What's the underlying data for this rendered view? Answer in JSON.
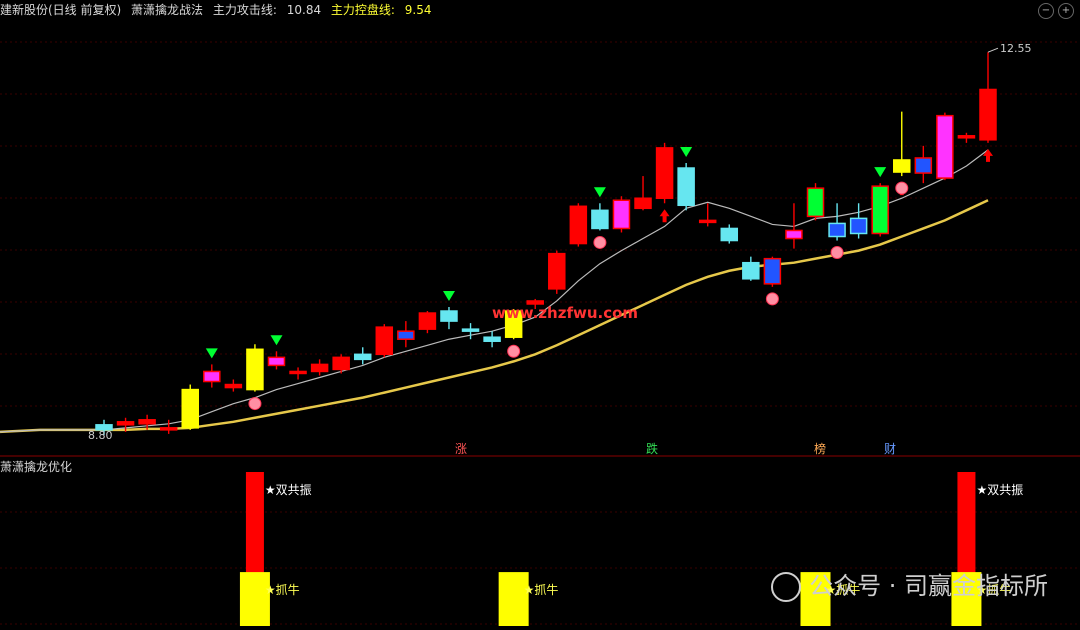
{
  "header": {
    "stock_title": "建新股份(日线 前复权)",
    "indicator_name": "萧潇擒龙战法",
    "attack_label": "主力攻击线:",
    "attack_value": "10.84",
    "control_label": "主力控盘线:",
    "control_value": "9.54"
  },
  "sub_panel": {
    "title": "萧潇擒龙优化"
  },
  "watermark_site": "www.zhzfwu.com",
  "signal_labels": {
    "up": "涨",
    "down": "跌",
    "rank": "榜",
    "wealth": "财"
  },
  "sub_labels": {
    "double": "★双共振",
    "bull": "★抓牛"
  },
  "footer_watermark": "公众号 · 司赢金指标所",
  "colors": {
    "up_red": "#ff0000",
    "cyan": "#66e6f0",
    "yellow": "#ffff00",
    "magenta": "#ff33ff",
    "blue": "#2255ff",
    "green": "#00ff33",
    "gray_line": "#bbbbbb",
    "gold_line": "#e6c84a"
  },
  "chart_data": {
    "type": "candlestick",
    "title": "建新股份(日线 前复权)",
    "ylim": [
      8.6,
      12.85
    ],
    "high_label": "12.55",
    "low_label": "8.80",
    "candles": [
      {
        "o": 8.8,
        "h": 8.9,
        "l": 8.75,
        "c": 8.85,
        "color": "cyan"
      },
      {
        "o": 8.85,
        "h": 8.92,
        "l": 8.78,
        "c": 8.88,
        "color": "red"
      },
      {
        "o": 8.86,
        "h": 8.95,
        "l": 8.8,
        "c": 8.9,
        "color": "red"
      },
      {
        "o": 8.8,
        "h": 8.9,
        "l": 8.76,
        "c": 8.82,
        "color": "red"
      },
      {
        "o": 8.82,
        "h": 9.25,
        "l": 8.8,
        "c": 9.2,
        "color": "yellow"
      },
      {
        "o": 9.28,
        "h": 9.45,
        "l": 9.22,
        "c": 9.38,
        "color": "red",
        "fill": "magenta"
      },
      {
        "o": 9.22,
        "h": 9.3,
        "l": 9.18,
        "c": 9.25,
        "color": "red"
      },
      {
        "o": 9.2,
        "h": 9.65,
        "l": 9.18,
        "c": 9.6,
        "color": "yellow"
      },
      {
        "o": 9.44,
        "h": 9.58,
        "l": 9.4,
        "c": 9.52,
        "color": "red",
        "fill": "magenta"
      },
      {
        "o": 9.36,
        "h": 9.42,
        "l": 9.3,
        "c": 9.38,
        "color": "red"
      },
      {
        "o": 9.38,
        "h": 9.5,
        "l": 9.34,
        "c": 9.45,
        "color": "red"
      },
      {
        "o": 9.4,
        "h": 9.55,
        "l": 9.36,
        "c": 9.52,
        "color": "red"
      },
      {
        "o": 9.5,
        "h": 9.62,
        "l": 9.45,
        "c": 9.55,
        "color": "cyan"
      },
      {
        "o": 9.55,
        "h": 9.85,
        "l": 9.52,
        "c": 9.82,
        "color": "red"
      },
      {
        "o": 9.7,
        "h": 9.88,
        "l": 9.62,
        "c": 9.78,
        "color": "red",
        "fill": "blue"
      },
      {
        "o": 9.8,
        "h": 9.98,
        "l": 9.76,
        "c": 9.96,
        "color": "red"
      },
      {
        "o": 9.88,
        "h": 10.02,
        "l": 9.8,
        "c": 9.98,
        "color": "cyan"
      },
      {
        "o": 9.8,
        "h": 9.86,
        "l": 9.7,
        "c": 9.78,
        "color": "cyan"
      },
      {
        "o": 9.72,
        "h": 9.78,
        "l": 9.62,
        "c": 9.68,
        "color": "cyan"
      },
      {
        "o": 9.72,
        "h": 10.0,
        "l": 9.7,
        "c": 9.98,
        "color": "yellow"
      },
      {
        "o": 10.05,
        "h": 10.1,
        "l": 10.0,
        "c": 10.08,
        "color": "red"
      },
      {
        "o": 10.2,
        "h": 10.58,
        "l": 10.15,
        "c": 10.55,
        "color": "red"
      },
      {
        "o": 10.65,
        "h": 11.05,
        "l": 10.62,
        "c": 11.02,
        "color": "red"
      },
      {
        "o": 10.8,
        "h": 11.05,
        "l": 10.78,
        "c": 10.98,
        "color": "cyan"
      },
      {
        "o": 10.8,
        "h": 11.12,
        "l": 10.76,
        "c": 11.08,
        "color": "red",
        "fill": "magenta"
      },
      {
        "o": 11.0,
        "h": 11.32,
        "l": 10.98,
        "c": 11.1,
        "color": "red"
      },
      {
        "o": 11.1,
        "h": 11.65,
        "l": 11.05,
        "c": 11.6,
        "color": "red"
      },
      {
        "o": 11.4,
        "h": 11.45,
        "l": 10.98,
        "c": 11.03,
        "color": "cyan"
      },
      {
        "o": 10.88,
        "h": 11.05,
        "l": 10.82,
        "c": 10.88,
        "color": "red"
      },
      {
        "o": 10.8,
        "h": 10.84,
        "l": 10.65,
        "c": 10.68,
        "color": "cyan"
      },
      {
        "o": 10.46,
        "h": 10.52,
        "l": 10.28,
        "c": 10.3,
        "color": "cyan"
      },
      {
        "o": 10.25,
        "h": 10.52,
        "l": 10.22,
        "c": 10.5,
        "color": "red",
        "fill": "blue"
      },
      {
        "o": 10.7,
        "h": 11.05,
        "l": 10.6,
        "c": 10.78,
        "color": "red",
        "fill": "magenta"
      },
      {
        "o": 10.92,
        "h": 11.25,
        "l": 10.88,
        "c": 11.2,
        "color": "red",
        "fill": "green"
      },
      {
        "o": 10.85,
        "h": 11.05,
        "l": 10.68,
        "c": 10.72,
        "color": "cyan",
        "fill": "blue"
      },
      {
        "o": 10.9,
        "h": 11.05,
        "l": 10.7,
        "c": 10.75,
        "color": "cyan",
        "fill": "blue"
      },
      {
        "o": 10.75,
        "h": 11.25,
        "l": 10.72,
        "c": 11.22,
        "color": "red",
        "fill": "green"
      },
      {
        "o": 11.36,
        "h": 11.96,
        "l": 11.32,
        "c": 11.48,
        "color": "yellow"
      },
      {
        "o": 11.5,
        "h": 11.62,
        "l": 11.25,
        "c": 11.35,
        "color": "red",
        "fill": "blue"
      },
      {
        "o": 11.3,
        "h": 11.95,
        "l": 11.28,
        "c": 11.92,
        "color": "red",
        "fill": "magenta"
      },
      {
        "o": 11.7,
        "h": 11.75,
        "l": 11.65,
        "c": 11.72,
        "color": "red"
      },
      {
        "o": 11.68,
        "h": 12.55,
        "l": 11.65,
        "c": 12.18,
        "color": "red"
      }
    ],
    "attack_line": [
      8.8,
      8.82,
      8.84,
      8.86,
      8.9,
      8.98,
      9.06,
      9.12,
      9.2,
      9.26,
      9.32,
      9.38,
      9.44,
      9.52,
      9.58,
      9.64,
      9.7,
      9.74,
      9.78,
      9.84,
      9.92,
      10.08,
      10.28,
      10.45,
      10.58,
      10.7,
      10.82,
      11.0,
      11.06,
      11.0,
      10.92,
      10.84,
      10.82,
      10.9,
      10.92,
      10.96,
      11.02,
      11.1,
      11.2,
      11.3,
      11.42,
      11.58
    ],
    "control_line": [
      8.8,
      8.8,
      8.81,
      8.81,
      8.82,
      8.85,
      8.88,
      8.92,
      8.96,
      9.0,
      9.04,
      9.08,
      9.12,
      9.17,
      9.22,
      9.27,
      9.32,
      9.37,
      9.42,
      9.48,
      9.55,
      9.64,
      9.74,
      9.84,
      9.94,
      10.04,
      10.14,
      10.24,
      10.32,
      10.38,
      10.42,
      10.44,
      10.46,
      10.5,
      10.54,
      10.58,
      10.64,
      10.72,
      10.8,
      10.88,
      10.98,
      11.08
    ],
    "down_markers": [
      5,
      8,
      16,
      23,
      27,
      36
    ],
    "up_markers": [
      26,
      37,
      41
    ],
    "sub_bars": [
      {
        "index": 7,
        "kind": "double",
        "color": "red",
        "value": 1.0
      },
      {
        "index": 7,
        "kind": "bull",
        "color": "yellow",
        "value": 0.35
      },
      {
        "index": 19,
        "kind": "bull",
        "color": "yellow",
        "value": 0.35
      },
      {
        "index": 33,
        "kind": "bull",
        "color": "yellow",
        "value": 0.35
      },
      {
        "index": 40,
        "kind": "double",
        "color": "red",
        "value": 1.0
      },
      {
        "index": 40,
        "kind": "bull",
        "color": "yellow",
        "value": 0.35
      }
    ]
  }
}
